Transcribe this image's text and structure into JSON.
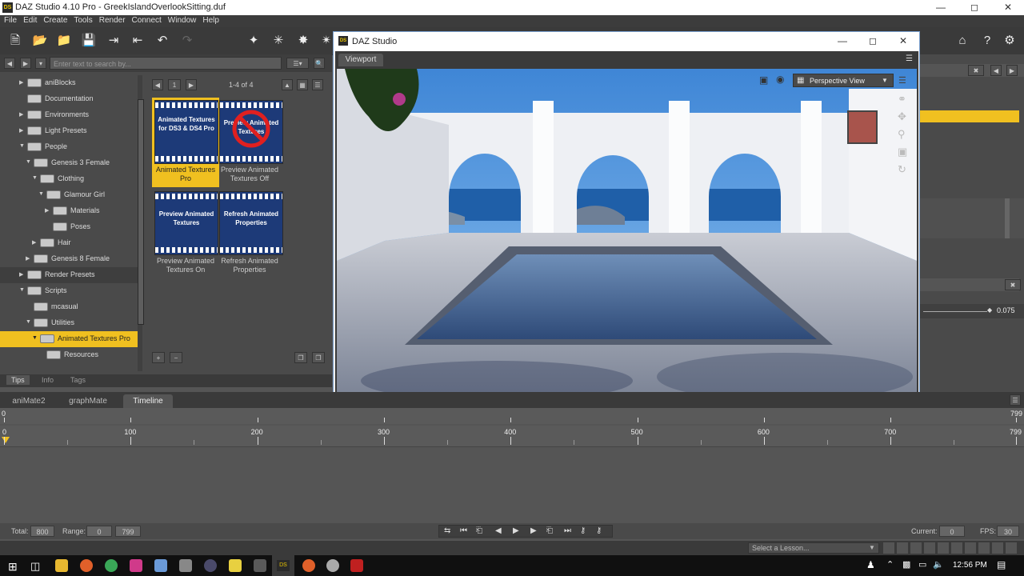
{
  "app": {
    "title": "DAZ Studio 4.10 Pro - GreekIslandOverlookSitting.duf",
    "logo": "DS"
  },
  "menu": [
    "File",
    "Edit",
    "Create",
    "Tools",
    "Render",
    "Connect",
    "Window",
    "Help"
  ],
  "library": {
    "search_placeholder": "Enter text to search by...",
    "page": "1",
    "page_range": "1-4 of 4",
    "tree": [
      {
        "label": "aniBlocks",
        "level": 1,
        "arrow": "▶"
      },
      {
        "label": "Documentation",
        "level": 1,
        "arrow": ""
      },
      {
        "label": "Environments",
        "level": 1,
        "arrow": "▶"
      },
      {
        "label": "Light Presets",
        "level": 1,
        "arrow": "▶"
      },
      {
        "label": "People",
        "level": 1,
        "arrow": "▼"
      },
      {
        "label": "Genesis 3 Female",
        "level": 2,
        "arrow": "▼"
      },
      {
        "label": "Clothing",
        "level": 3,
        "arrow": "▼"
      },
      {
        "label": "Glamour Girl",
        "level": 4,
        "arrow": "▼"
      },
      {
        "label": "Materials",
        "level": 5,
        "arrow": "▶"
      },
      {
        "label": "Poses",
        "level": 5,
        "arrow": ""
      },
      {
        "label": "Hair",
        "level": 3,
        "arrow": "▶"
      },
      {
        "label": "Genesis 8 Female",
        "level": 2,
        "arrow": "▶"
      },
      {
        "label": "Render Presets",
        "level": 1,
        "arrow": "▶"
      },
      {
        "label": "Scripts",
        "level": 1,
        "arrow": "▼"
      },
      {
        "label": "mcasual",
        "level": 2,
        "arrow": ""
      },
      {
        "label": "Utilities",
        "level": 2,
        "arrow": "▼"
      },
      {
        "label": "Animated Textures Pro",
        "level": 3,
        "arrow": "▼"
      },
      {
        "label": "Resources",
        "level": 4,
        "arrow": ""
      }
    ],
    "items": [
      {
        "thumb_text": "Animated Textures for DS3 & DS4 Pro",
        "label": "Animated Textures Pro"
      },
      {
        "thumb_text": "Preview Animated Textures",
        "label": "Preview Animated Textures Off"
      },
      {
        "thumb_text": "Preview Animated Textures",
        "label": "Preview Animated Textures On"
      },
      {
        "thumb_text": "Refresh Animated Properties",
        "label": "Refresh Animated Properties"
      }
    ],
    "bottom_tabs": [
      "Tips",
      "Info",
      "Tags"
    ]
  },
  "viewport": {
    "window_title": "DAZ Studio",
    "tab": "Viewport",
    "view_mode": "Perspective View"
  },
  "right_panel": {
    "value": "0.075"
  },
  "timeline": {
    "tabs": [
      "aniMate2",
      "graphMate",
      "Timeline"
    ],
    "start": "0",
    "end": "799",
    "ticks": [
      "0",
      "100",
      "200",
      "300",
      "400",
      "500",
      "600",
      "700",
      "799"
    ],
    "total_label": "Total:",
    "total": "800",
    "range_label": "Range:",
    "range_start": "0",
    "range_end": "799",
    "current_label": "Current:",
    "current": "0",
    "fps_label": "FPS:",
    "fps": "30"
  },
  "status": {
    "lesson_placeholder": "Select a Lesson..."
  },
  "taskbar": {
    "time": "12:56 PM"
  }
}
